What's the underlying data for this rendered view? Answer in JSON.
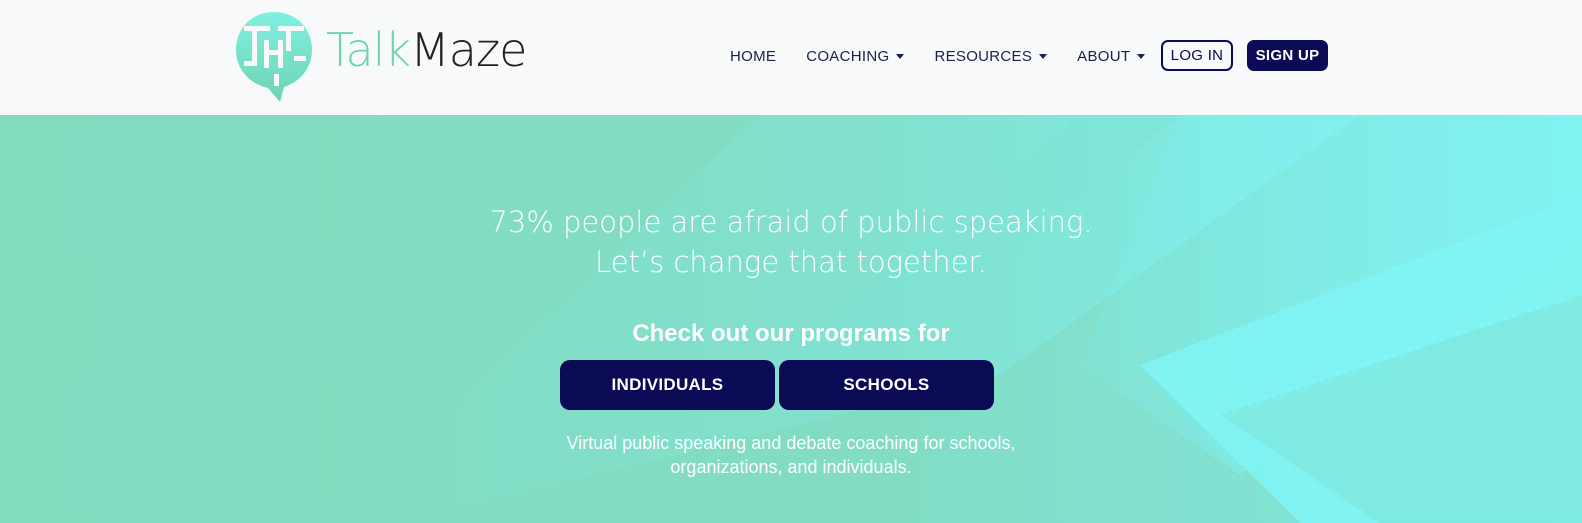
{
  "brand": {
    "name_part1": "Talk",
    "name_part2": "Maze"
  },
  "nav": {
    "items": [
      {
        "label": "HOME",
        "dropdown": false
      },
      {
        "label": "COACHING",
        "dropdown": true
      },
      {
        "label": "RESOURCES",
        "dropdown": true
      },
      {
        "label": "ABOUT",
        "dropdown": true
      }
    ],
    "login_label": "LOG IN",
    "signup_label": "SIGN UP"
  },
  "hero": {
    "headline_line1": "73% people are afraid of public speaking.",
    "headline_line2": "Let’s change that together.",
    "programs_label": "Check out our programs for",
    "individuals_label": "INDIVIDUALS",
    "schools_label": "SCHOOLS",
    "subtext_line1": "Virtual public speaking and debate coaching for schools,",
    "subtext_line2": "organizations, and individuals."
  },
  "colors": {
    "brand_navy": "#0b0a55",
    "brand_mint": "#6fd4b3",
    "hero_mint": "#81dbbf",
    "hero_cyan": "#7ff4f6"
  }
}
